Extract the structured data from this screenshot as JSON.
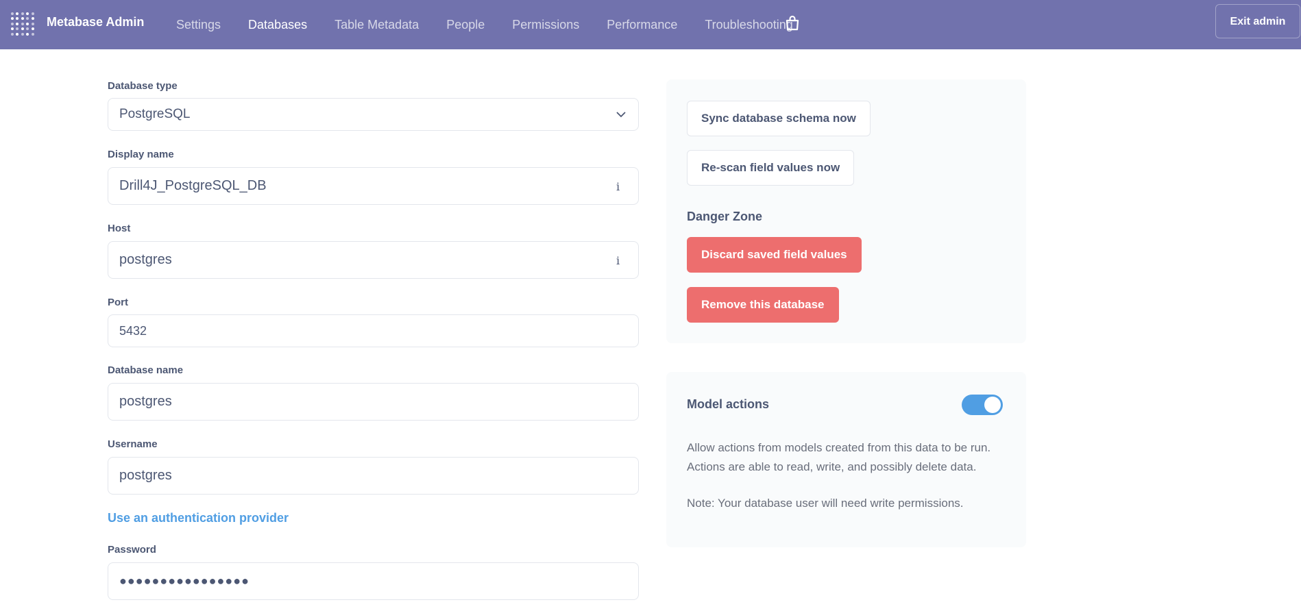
{
  "nav": {
    "brand": "Metabase Admin",
    "links": [
      "Settings",
      "Databases",
      "Table Metadata",
      "People",
      "Permissions",
      "Performance",
      "Troubleshooting"
    ],
    "active": "Databases",
    "store_icon": "shopping-bag-icon",
    "exit_label": "Exit admin"
  },
  "form": {
    "database_type": {
      "label": "Database type",
      "value": "PostgreSQL"
    },
    "display_name": {
      "label": "Display name",
      "value": "Drill4J_PostgreSQL_DB"
    },
    "host": {
      "label": "Host",
      "value": "postgres"
    },
    "port": {
      "label": "Port",
      "value": "5432"
    },
    "database_name": {
      "label": "Database name",
      "value": "postgres"
    },
    "username": {
      "label": "Username",
      "value": "postgres"
    },
    "auth_link": "Use an authentication provider",
    "password": {
      "label": "Password",
      "value": "●●●●●●●●●●●●●●●●"
    }
  },
  "actions": {
    "sync": "Sync database schema now",
    "rescan": "Re-scan field values now",
    "danger_zone": "Danger Zone",
    "discard": "Discard saved field values",
    "remove": "Remove this database"
  },
  "model_actions": {
    "title": "Model actions",
    "enabled": true,
    "description": "Allow actions from models created from this data to be run. Actions are able to read, write, and possibly delete data.",
    "note": "Note: Your database user will need write permissions."
  },
  "colors": {
    "nav_bg": "#7172ad",
    "link": "#509ee3",
    "danger": "#ed6e6e",
    "toggle_on": "#509ee3"
  }
}
